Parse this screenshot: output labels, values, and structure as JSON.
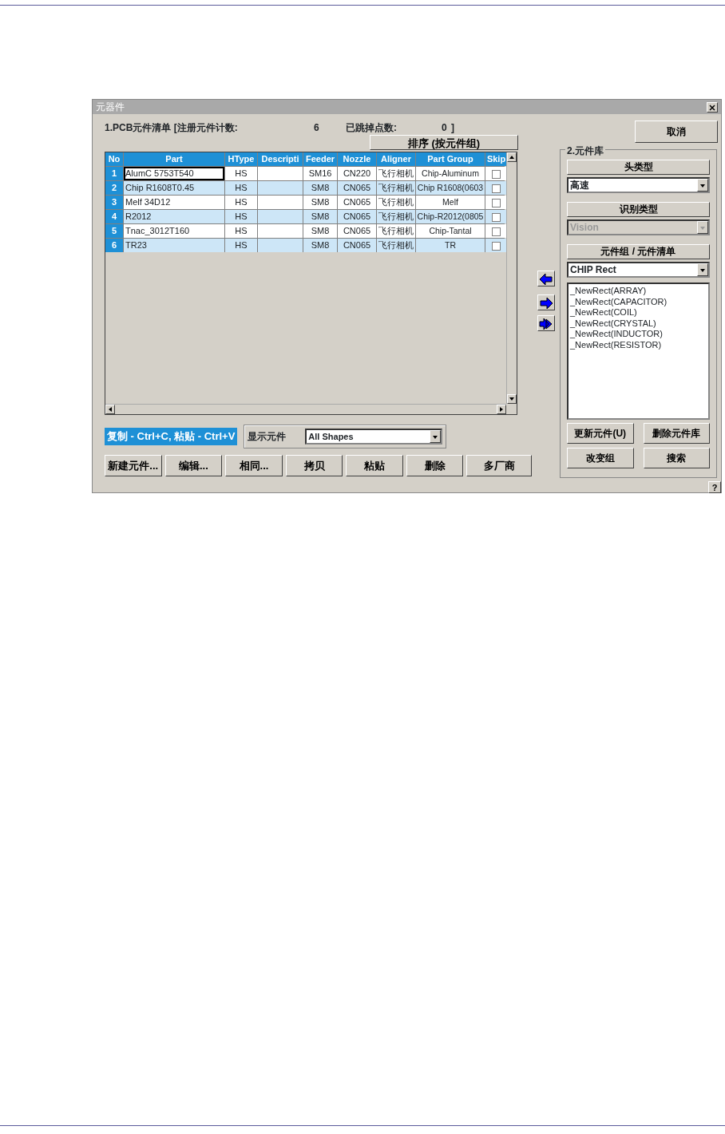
{
  "window": {
    "title": "元器件"
  },
  "summary": {
    "label": "1.PCB元件清单 [注册元件计数:",
    "count": "6",
    "skipped_label": "已跳掉点数:",
    "skipped": "0",
    "close": "]"
  },
  "sort_button": "排序 (按元件组)",
  "table": {
    "columns": [
      "No",
      "Part",
      "HType",
      "Descripti",
      "Feeder",
      "Nozzle",
      "Aligner",
      "Part Group",
      "Skip"
    ],
    "rows": [
      {
        "no": "1",
        "part": "AlumC 5753T540",
        "htype": "HS",
        "feeder": "SM16",
        "nozzle": "CN220",
        "aligner": "飞行相机",
        "group": "Chip-Aluminum",
        "skip": false,
        "current": true
      },
      {
        "no": "2",
        "part": "Chip R1608T0.45",
        "htype": "HS",
        "feeder": "SM8",
        "nozzle": "CN065",
        "aligner": "飞行相机",
        "group": "Chip R1608(0603",
        "skip": false,
        "current": false
      },
      {
        "no": "3",
        "part": "Melf 34D12",
        "htype": "HS",
        "feeder": "SM8",
        "nozzle": "CN065",
        "aligner": "飞行相机",
        "group": "Melf",
        "skip": false,
        "current": false
      },
      {
        "no": "4",
        "part": "R2012",
        "htype": "HS",
        "feeder": "SM8",
        "nozzle": "CN065",
        "aligner": "飞行相机",
        "group": "Chip-R2012(0805",
        "skip": false,
        "current": false
      },
      {
        "no": "5",
        "part": "Tnac_3012T160",
        "htype": "HS",
        "feeder": "SM8",
        "nozzle": "CN065",
        "aligner": "飞行相机",
        "group": "Chip-Tantal",
        "skip": false,
        "current": false
      },
      {
        "no": "6",
        "part": "TR23",
        "htype": "HS",
        "feeder": "SM8",
        "nozzle": "CN065",
        "aligner": "飞行相机",
        "group": "TR",
        "skip": false,
        "current": false
      }
    ]
  },
  "hint": "复制 - Ctrl+C, 粘贴 - Ctrl+V",
  "display": {
    "label": "显示元件",
    "value": "All Shapes"
  },
  "buttons": [
    "新建元件...",
    "编辑...",
    "相同...",
    "拷贝",
    "粘贴",
    "删除",
    "多厂商"
  ],
  "cancel_button": "取消",
  "library": {
    "title": "2.元件库",
    "sections": [
      {
        "header": "头类型",
        "value": "高速",
        "disabled": false
      },
      {
        "header": "识别类型",
        "value": "Vision",
        "disabled": true
      },
      {
        "header": "元件组 / 元件清单",
        "value": "CHIP Rect",
        "disabled": false
      }
    ],
    "items": [
      "_NewRect(ARRAY)",
      "_NewRect(CAPACITOR)",
      "_NewRect(COIL)",
      "_NewRect(CRYSTAL)",
      "_NewRect(INDUCTOR)",
      "_NewRect(RESISTOR)"
    ],
    "buttons": [
      "更新元件(U)",
      "删除元件库",
      "改变组",
      "搜索"
    ]
  },
  "help": "?"
}
